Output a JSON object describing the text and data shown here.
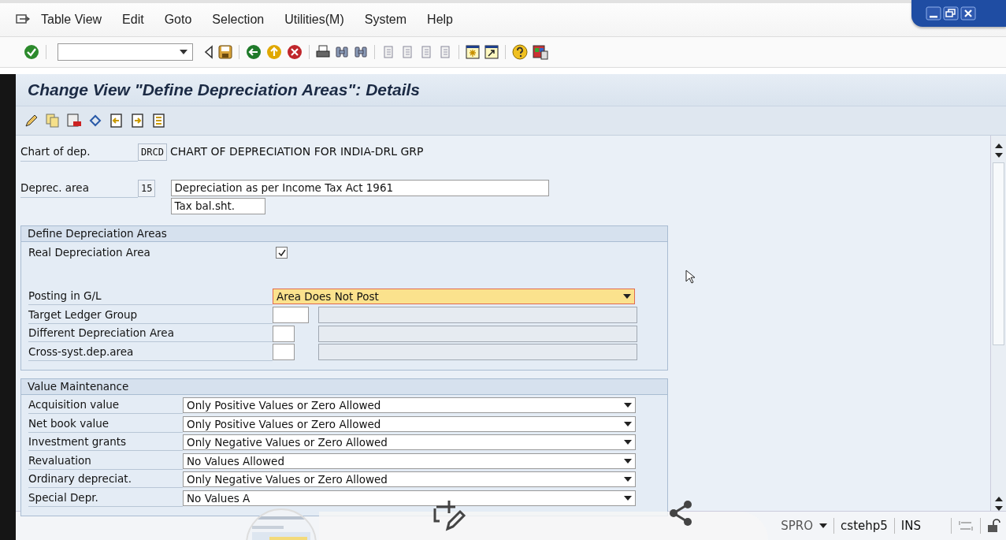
{
  "menu_bar": {
    "items": [
      "Table View",
      "Edit",
      "Goto",
      "Selection",
      "Utilities(M)",
      "System",
      "Help"
    ]
  },
  "title": "Change View \"Define Depreciation Areas\": Details",
  "header_fields": [
    {
      "label": "Chart of dep.",
      "code": "DRCD",
      "description": "CHART OF DEPRECIATION FOR INDIA-DRL GRP"
    },
    {
      "label": "Deprec. area",
      "code": "15",
      "description": "Depreciation as per Income Tax  Act 1961",
      "short_text": "Tax bal.sht."
    }
  ],
  "define_section": {
    "title": "Define Depreciation Areas",
    "rows": [
      {
        "kind": "checkbox",
        "label": "Real Depreciation Area",
        "checked": true
      },
      {
        "kind": "dropdown",
        "label": "Posting in G/L",
        "value": "Area Does Not Post",
        "focused": true
      },
      {
        "kind": "wide_field",
        "label": "Target Ledger Group"
      },
      {
        "kind": "field",
        "label": "Different Depreciation Area"
      },
      {
        "kind": "field",
        "label": "Cross-syst.dep.area"
      }
    ]
  },
  "value_maintenance": {
    "title": "Value Maintenance",
    "rows": [
      {
        "label": "Acquisition value",
        "value": "Only Positive Values or Zero Allowed"
      },
      {
        "label": "Net book value",
        "value": "Only Positive Values or Zero Allowed"
      },
      {
        "label": "Investment grants",
        "value": "Only Negative Values or Zero Allowed"
      },
      {
        "label": "Revaluation",
        "value": "No Values Allowed"
      },
      {
        "label": "Ordinary depreciat.",
        "value": "Only Negative Values or Zero Allowed"
      },
      {
        "label": "Special Depr.",
        "value": "No Values A"
      }
    ]
  },
  "status_bar": {
    "transaction": "SPRO",
    "server": "cstehp5",
    "mode": "INS"
  }
}
